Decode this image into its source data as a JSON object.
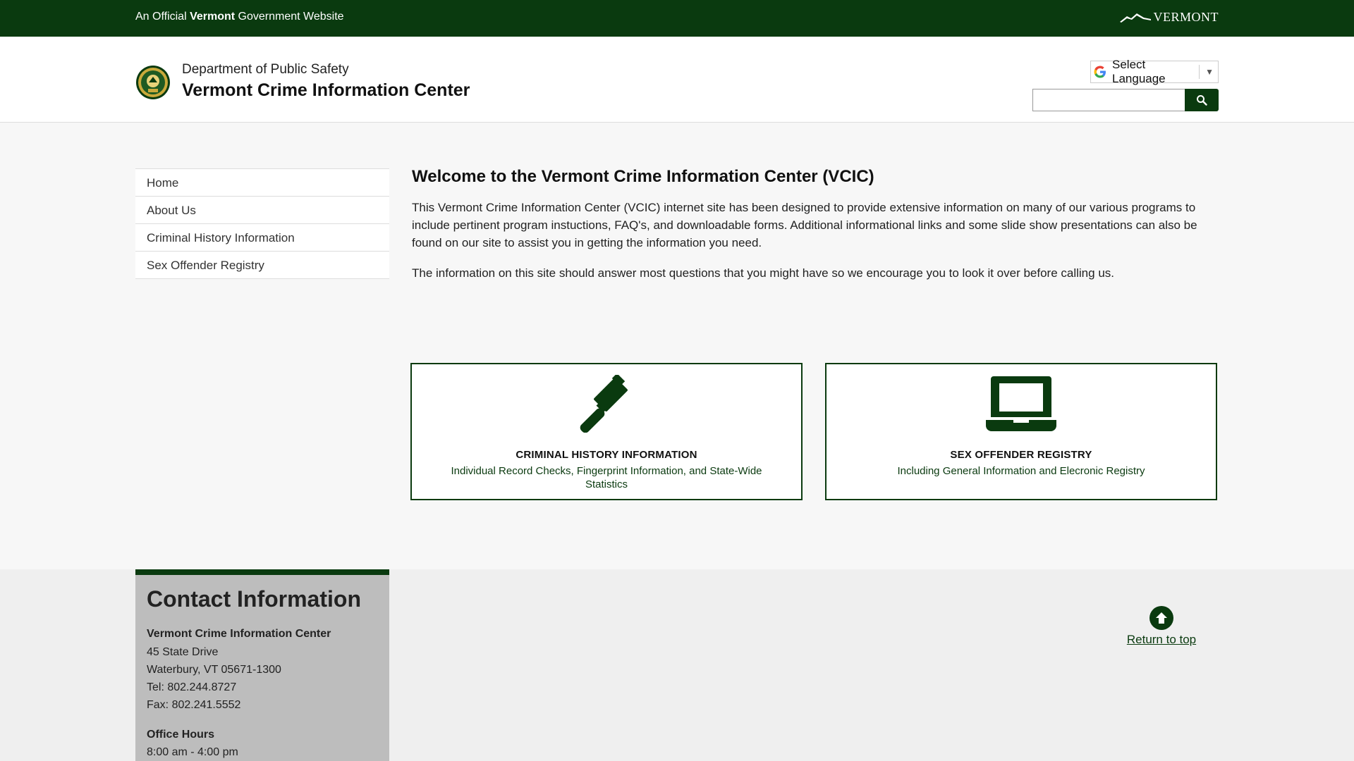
{
  "topbar": {
    "official_prefix": "An Official",
    "official_bold": "Vermont",
    "official_suffix": "Government Website",
    "state_logo_text": "VERMONT"
  },
  "header": {
    "department": "Department of Public Safety",
    "site_title": "Vermont Crime Information Center",
    "language_label": "Select Language",
    "search_placeholder": ""
  },
  "sidenav": {
    "items": [
      {
        "label": "Home"
      },
      {
        "label": "About Us"
      },
      {
        "label": "Criminal History Information"
      },
      {
        "label": "Sex Offender Registry"
      }
    ]
  },
  "main": {
    "heading": "Welcome to the Vermont Crime Information Center (VCIC)",
    "paragraph1": "This Vermont Crime Information Center (VCIC) internet site has been designed to provide extensive information on many of our various programs to include pertinent program instuctions, FAQ's, and downloadable forms.  Additional informational links and some slide show presentations can also be found on our site to assist you in getting the information you need.",
    "paragraph2": "The information on this site should answer most questions that you might have so we encourage you to look it over before calling us.",
    "cards": [
      {
        "icon": "gavel-icon",
        "title": "CRIMINAL HISTORY INFORMATION",
        "description": "Individual Record Checks, Fingerprint Information, and State-Wide Statistics"
      },
      {
        "icon": "laptop-icon",
        "title": "SEX OFFENDER REGISTRY",
        "description": "Including General Information and Elecronic Registry"
      }
    ]
  },
  "footer": {
    "contact_heading": "Contact Information",
    "org_name": "Vermont Crime Information Center",
    "address1": "45 State Drive",
    "address2": "Waterbury,  VT  05671-1300",
    "tel": "Tel: 802.244.8727",
    "fax": "Fax: 802.241.5552",
    "hours_title": "Office Hours",
    "hours": "8:00 am - 4:00 pm",
    "return_to_top": "Return to top"
  },
  "colors": {
    "brand_green": "#0a3a0f"
  }
}
